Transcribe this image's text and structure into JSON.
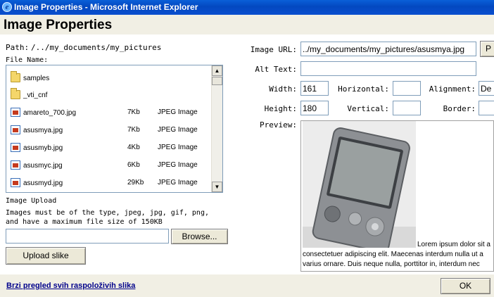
{
  "window": {
    "title": "Image Properties - Microsoft Internet Explorer"
  },
  "dialog": {
    "heading": "Image Properties"
  },
  "path": {
    "label": "Path:",
    "value": "/../my_documents/my_pictures"
  },
  "file_list": {
    "label": "File Name:",
    "items": [
      {
        "name": "samples",
        "size": "",
        "type": "",
        "icon": "folder-icon"
      },
      {
        "name": "_vti_cnf",
        "size": "",
        "type": "",
        "icon": "folder-icon"
      },
      {
        "name": "amareto_700.jpg",
        "size": "7Kb",
        "type": "JPEG Image",
        "icon": "image-file-icon"
      },
      {
        "name": "asusmya.jpg",
        "size": "7Kb",
        "type": "JPEG Image",
        "icon": "image-file-icon"
      },
      {
        "name": "asusmyb.jpg",
        "size": "4Kb",
        "type": "JPEG Image",
        "icon": "image-file-icon"
      },
      {
        "name": "asusmyc.jpg",
        "size": "6Kb",
        "type": "JPEG Image",
        "icon": "image-file-icon"
      },
      {
        "name": "asusmyd.jpg",
        "size": "29Kb",
        "type": "JPEG Image",
        "icon": "image-file-icon"
      }
    ]
  },
  "upload": {
    "title": "Image Upload",
    "note": "Images must be of the type, jpeg, jpg, gif, png, and have a maximum file size of 150KB",
    "file_value": "",
    "browse_label": "Browse...",
    "upload_label": "Upload slike"
  },
  "props": {
    "image_url_label": "Image URL:",
    "image_url_value": "../my_documents/my_pictures/asusmya.jpg",
    "p_button_label": "P",
    "alt_text_label": "Alt Text:",
    "alt_text_value": "",
    "width_label": "Width:",
    "width_value": "161",
    "height_label": "Height:",
    "height_value": "180",
    "horizontal_label": "Horizontal:",
    "horizontal_value": "",
    "vertical_label": "Vertical:",
    "vertical_value": "",
    "alignment_label": "Alignment:",
    "alignment_value": "De",
    "border_label": "Border:",
    "border_value": "",
    "preview_label": "Preview:"
  },
  "preview": {
    "text_line1": "Lorem ipsum dolor sit a",
    "text_line2": "consectetuer adipiscing elit. Maecenas interdum nulla ut a",
    "text_line3": "varius ornare. Duis neque nulla, porttitor in, interdum nec"
  },
  "footer": {
    "link_label": "Brzi pregled svih raspoloživih slika",
    "ok_label": "OK"
  }
}
